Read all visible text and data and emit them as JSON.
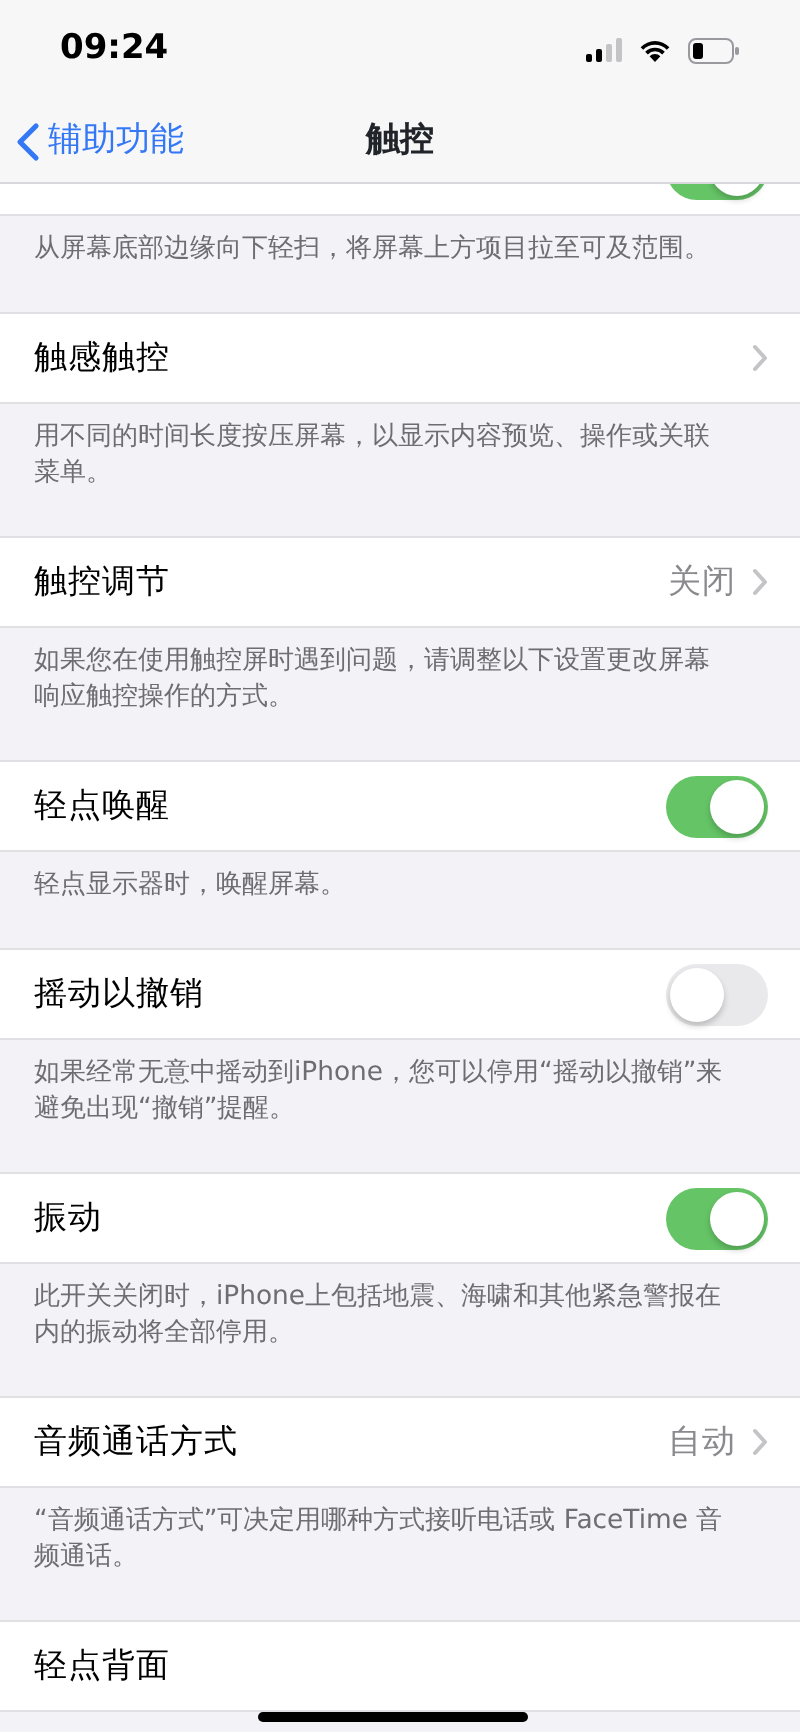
{
  "status_bar": {
    "time": "09:24"
  },
  "nav": {
    "back": "辅助功能",
    "title": "触控"
  },
  "items": [
    {
      "kind": "toggle",
      "on": true,
      "footer": "从屏幕底部边缘向下轻扫，将屏幕上方项目拉至可及范围。"
    },
    {
      "kind": "link",
      "label": "触感触控",
      "footer": "用不同的时间长度按压屏幕，以显示内容预览、操作或关联菜单。"
    },
    {
      "kind": "link",
      "label": "触控调节",
      "value": "关闭",
      "footer": "如果您在使用触控屏时遇到问题，请调整以下设置更改屏幕响应触控操作的方式。"
    },
    {
      "kind": "toggle",
      "label": "轻点唤醒",
      "on": true,
      "footer": "轻点显示器时，唤醒屏幕。"
    },
    {
      "kind": "toggle",
      "label": "摇动以撤销",
      "on": false,
      "footer": "如果经常无意中摇动到iPhone，您可以停用“摇动以撤销”来避免出现“撤销”提醒。"
    },
    {
      "kind": "toggle",
      "label": "振动",
      "on": true,
      "footer": "此开关关闭时，iPhone上包括地震、海啸和其他紧急警报在内的振动将全部停用。"
    },
    {
      "kind": "link",
      "label": "音频通话方式",
      "value": "自动",
      "footer": "“音频通话方式”可决定用哪种方式接听电话或 FaceTime 音频通话。"
    },
    {
      "kind": "plain",
      "label": "轻点背面"
    }
  ]
}
